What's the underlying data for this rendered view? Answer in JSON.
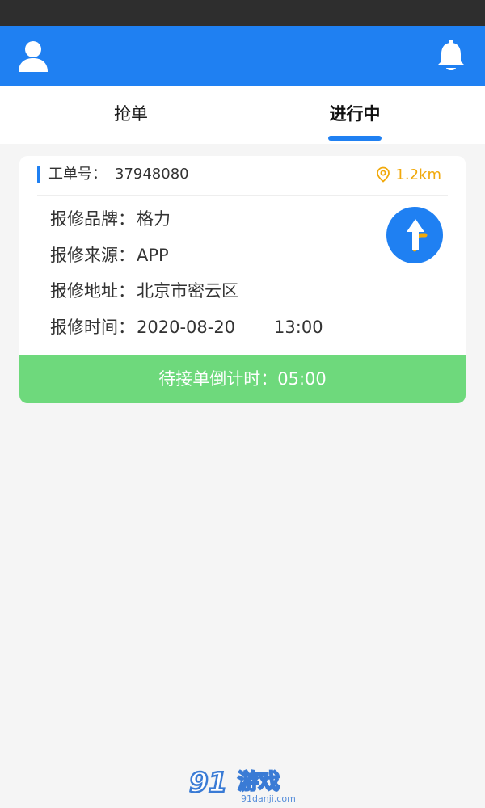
{
  "tabs": [
    {
      "label": "抢单"
    },
    {
      "label": "进行中"
    }
  ],
  "order": {
    "number_label": "工单号：",
    "number": "37948080",
    "distance": "1.2km",
    "fields": [
      {
        "label": "报修品牌：",
        "value": "格力"
      },
      {
        "label": "报修来源：",
        "value": "APP"
      },
      {
        "label": "报修地址：",
        "value": "北京市密云区"
      },
      {
        "label": "报修时间：",
        "value": "2020-08-20",
        "extra": "13:00"
      }
    ],
    "countdown": "待接单倒计时：05:00"
  },
  "watermark": {
    "logo": "91游戏",
    "site": "91danji.com"
  },
  "colors": {
    "primary": "#1f80f2",
    "status_bar": "#2e2e2e",
    "distance": "#f1a90b",
    "countdown_bg": "#6ed97c"
  }
}
